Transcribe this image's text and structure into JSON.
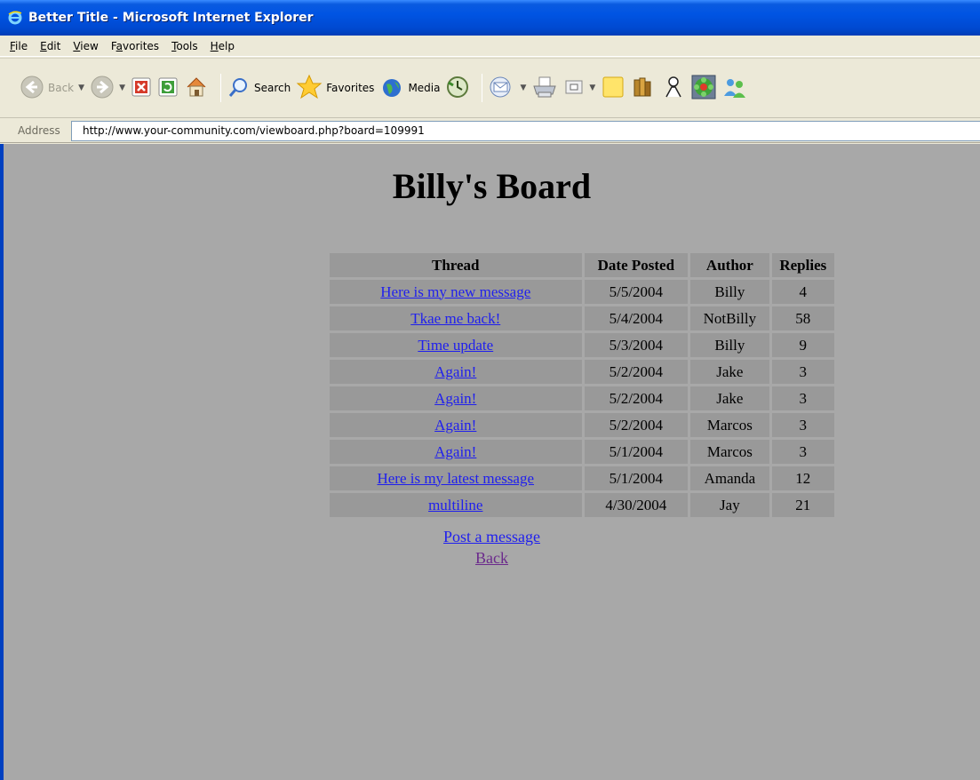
{
  "window": {
    "title": "Better Title - Microsoft Internet Explorer"
  },
  "menu": [
    {
      "label": "File",
      "accel": "F",
      "rest": "ile"
    },
    {
      "label": "Edit",
      "accel": "E",
      "rest": "dit"
    },
    {
      "label": "View",
      "accel": "V",
      "rest": "iew"
    },
    {
      "label": "Favorites",
      "pre": "F",
      "accel": "a",
      "rest": "vorites"
    },
    {
      "label": "Tools",
      "accel": "T",
      "rest": "ools"
    },
    {
      "label": "Help",
      "accel": "H",
      "rest": "elp"
    }
  ],
  "toolbar": {
    "back_label": "Back",
    "search_label": "Search",
    "favorites_label": "Favorites",
    "media_label": "Media"
  },
  "address": {
    "label": "Address",
    "url": "http://www.your-community.com/viewboard.php?board=109991"
  },
  "page": {
    "heading": "Billy's Board",
    "columns": [
      "Thread",
      "Date Posted",
      "Author",
      "Replies"
    ],
    "rows": [
      {
        "thread": "Here is my new message",
        "date": "5/5/2004",
        "author": "Billy",
        "replies": "4"
      },
      {
        "thread": "Tkae me back!",
        "date": "5/4/2004",
        "author": "NotBilly",
        "replies": "58"
      },
      {
        "thread": "Time update",
        "date": "5/3/2004",
        "author": "Billy",
        "replies": "9"
      },
      {
        "thread": "Again!",
        "date": "5/2/2004",
        "author": "Jake",
        "replies": "3"
      },
      {
        "thread": "Again!",
        "date": "5/2/2004",
        "author": "Jake",
        "replies": "3"
      },
      {
        "thread": "Again!",
        "date": "5/2/2004",
        "author": "Marcos",
        "replies": "3"
      },
      {
        "thread": "Again!",
        "date": "5/1/2004",
        "author": "Marcos",
        "replies": "3"
      },
      {
        "thread": "Here is my latest message",
        "date": "5/1/2004",
        "author": "Amanda",
        "replies": "12"
      },
      {
        "thread": "multiline",
        "date": "4/30/2004",
        "author": "Jay",
        "replies": "21"
      }
    ],
    "post_link": "Post a message",
    "back_link": "Back"
  },
  "colors": {
    "content_bg": "#A8A8A8",
    "cell_bg": "#999999",
    "link": "#1F1FEE",
    "visited_link": "#6B2A8C"
  }
}
